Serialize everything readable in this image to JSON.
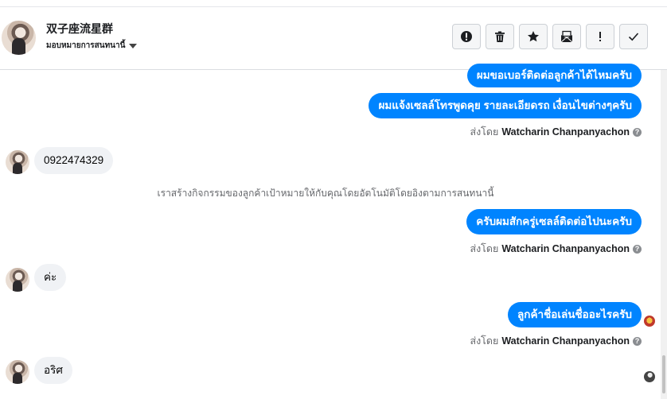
{
  "header": {
    "title": "双子座流星群",
    "subtitle": "มอบหมายการสนทนานี้"
  },
  "toolbar": {
    "buttons": [
      {
        "name": "report-button",
        "icon": "alert-circle-icon"
      },
      {
        "name": "delete-button",
        "icon": "trash-icon"
      },
      {
        "name": "star-button",
        "icon": "star-icon"
      },
      {
        "name": "mark-unread-button",
        "icon": "envelope-icon"
      },
      {
        "name": "follow-up-button",
        "icon": "exclamation-icon"
      },
      {
        "name": "mark-done-button",
        "icon": "check-icon"
      }
    ]
  },
  "messages": {
    "out1": "ผมขอเบอร์ติดต่อลูกค้าได้ไหมครับ",
    "out2": "ผมแจ้งเซลล์โทรพูดคุย รายละเอียดรถ เงื่อนไขต่างๆครับ",
    "sender_prefix": "ส่งโดย",
    "sender_name": "Watcharin Chanpanyachon",
    "in1": "0922474329",
    "system": "เราสร้างกิจกรรมของลูกค้าเป้าหมายให้กับคุณโดยอัตโนมัติโดยอิงตามการสนทนานี้",
    "out3": "ครับผมสักครู่เซลล์ติดต่อไปนะครับ",
    "in2": "ค่ะ",
    "out4": "ลูกค้าชื่อเล่นชื่ออะไรครับ",
    "in3": "อริศ"
  },
  "colors": {
    "accent": "#0084ff",
    "incoming_bubble": "#f0f2f5"
  }
}
